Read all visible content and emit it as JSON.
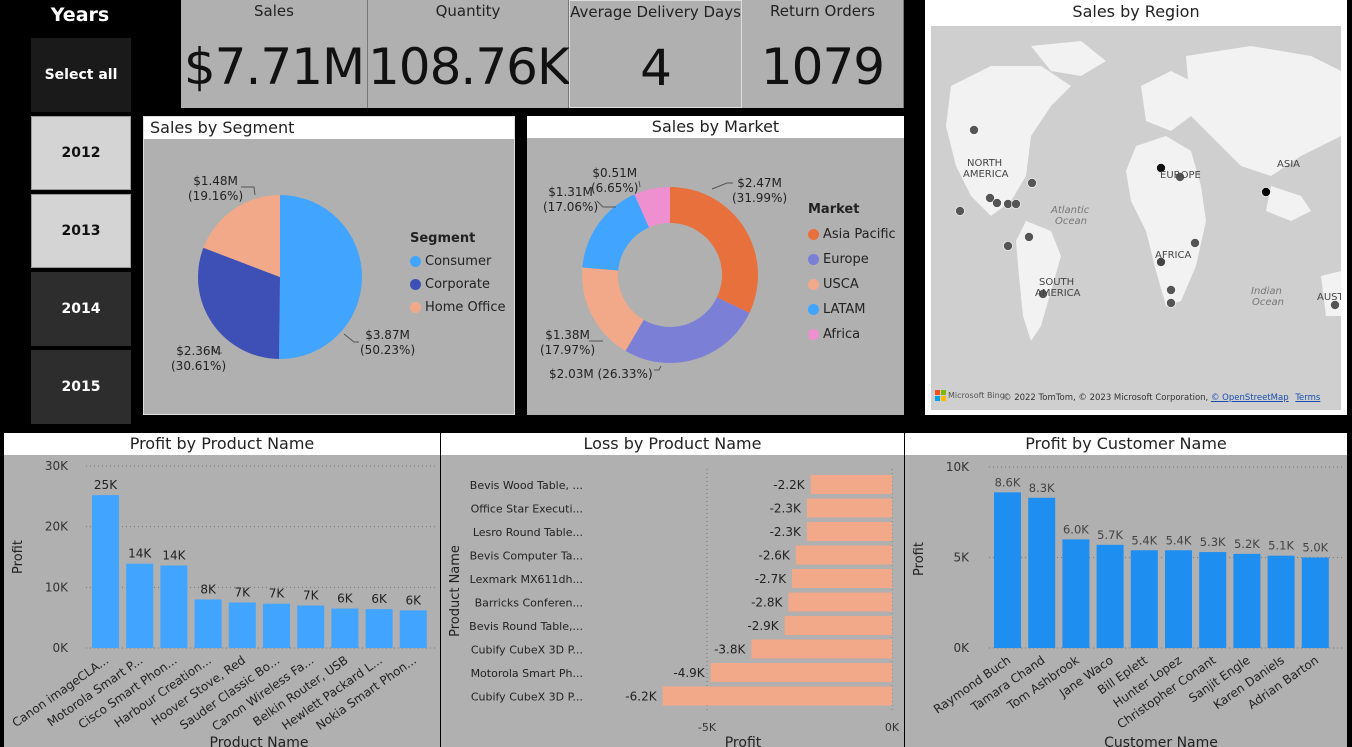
{
  "slicer": {
    "title": "Years",
    "items": [
      {
        "label": "Select all",
        "style": "sel"
      },
      {
        "label": "2012",
        "style": "light"
      },
      {
        "label": "2013",
        "style": "light"
      },
      {
        "label": "2014",
        "style": "dark"
      },
      {
        "label": "2015",
        "style": "dark"
      }
    ]
  },
  "kpis": [
    {
      "label": "Sales",
      "value": "$7.71M"
    },
    {
      "label": "Quantity",
      "value": "108.76K"
    },
    {
      "label": "Average Delivery Days",
      "value": "4"
    },
    {
      "label": "Return Orders",
      "value": "1079"
    }
  ],
  "map": {
    "title": "Sales by Region",
    "labels": [
      "NORTH\nAMERICA",
      "EUROPE",
      "ASIA",
      "AFRICA",
      "SOUTH\nAMERICA",
      "Atlantic\nOcean",
      "Indian\nOcean",
      "AUST"
    ],
    "bing_logo": "Microsoft Bing",
    "copyright": "© 2022 TomTom, © 2023 Microsoft Corporation,",
    "osm_link": "© OpenStreetMap",
    "terms_link": "Terms"
  },
  "segment": {
    "title": "Sales by Segment",
    "legend_title": "Segment",
    "labels": [
      {
        "value": "$3.87M",
        "pct": "(50.23%)"
      },
      {
        "value": "$2.36M",
        "pct": "(30.61%)"
      },
      {
        "value": "$1.48M",
        "pct": "(19.16%)"
      }
    ]
  },
  "market": {
    "title": "Sales by Market",
    "legend_title": "Market",
    "labels": [
      {
        "value": "$2.47M",
        "pct": "(31.99%)"
      },
      {
        "value": "$2.03M (26.33%)",
        "pct": ""
      },
      {
        "value": "$1.38M",
        "pct": "(17.97%)"
      },
      {
        "value": "$1.31M",
        "pct": "(17.06%)"
      },
      {
        "value": "$0.51M",
        "pct": "(6.65%)"
      }
    ]
  },
  "profit_product": {
    "title": "Profit by Product Name",
    "ylabel": "Profit",
    "xlabel": "Product Name",
    "yticks": [
      "30K",
      "20K",
      "10K",
      "0K"
    ]
  },
  "loss_product": {
    "title": "Loss by Product Name",
    "ylabel": "Product Name",
    "xlabel": "Profit",
    "xticks": [
      "-5K",
      "0K"
    ]
  },
  "profit_customer": {
    "title": "Profit by Customer Name",
    "ylabel": "Profit",
    "xlabel": "Customer Name",
    "yticks": [
      "10K",
      "5K",
      "0K"
    ]
  },
  "colors": {
    "consumer": "#41A4FF",
    "corporate": "#3E4FB5",
    "home_office": "#F2A98A",
    "asia_pacific": "#E8703C",
    "europe": "#7B7FD6",
    "usca": "#F2A98A",
    "latam": "#41A4FF",
    "africa": "#EE8FD0",
    "bar_blue": "#41A4FF",
    "bar_blue2": "#1E8EF0",
    "bar_salmon": "#F2A98A"
  },
  "chart_data": [
    {
      "type": "pie",
      "title": "Sales by Segment",
      "categories": [
        "Consumer",
        "Corporate",
        "Home Office"
      ],
      "values": [
        3.87,
        2.36,
        1.48
      ],
      "percents": [
        50.23,
        30.61,
        19.16
      ],
      "unit": "$M"
    },
    {
      "type": "pie",
      "subtype": "donut",
      "title": "Sales by Market",
      "categories": [
        "Asia Pacific",
        "Europe",
        "USCA",
        "LATAM",
        "Africa"
      ],
      "values": [
        2.47,
        2.03,
        1.38,
        1.31,
        0.51
      ],
      "percents": [
        31.99,
        26.33,
        17.97,
        17.06,
        6.65
      ],
      "unit": "$M"
    },
    {
      "type": "bar",
      "title": "Profit by Product Name",
      "xlabel": "Product Name",
      "ylabel": "Profit",
      "categories": [
        "Canon imageCLA...",
        "Motorola Smart P...",
        "Cisco Smart Phon...",
        "Harbour Creation...",
        "Hoover Stove, Red",
        "Sauder Classic Bo...",
        "Canon Wireless Fa...",
        "Belkin Router, USB",
        "Hewlett Packard L...",
        "Nokia Smart Phon..."
      ],
      "values": [
        25000,
        14000,
        14000,
        8000,
        7000,
        7000,
        7000,
        6000,
        6000,
        6000
      ],
      "data_labels": [
        "25K",
        "14K",
        "14K",
        "8K",
        "7K",
        "7K",
        "7K",
        "6K",
        "6K",
        "6K"
      ],
      "heights": [
        25.2,
        13.9,
        13.6,
        8.0,
        7.5,
        7.3,
        7.0,
        6.5,
        6.4,
        6.2
      ],
      "ylim": [
        0,
        30000
      ]
    },
    {
      "type": "bar",
      "orientation": "horizontal",
      "title": "Loss by Product Name",
      "xlabel": "Profit",
      "ylabel": "Product Name",
      "categories": [
        "Bevis Wood Table, ...",
        "Office Star Executi...",
        "Lesro Round Table...",
        "Bevis Computer Ta...",
        "Lexmark MX611dh...",
        "Barricks Conferen...",
        "Bevis Round Table,...",
        "Cubify CubeX 3D P...",
        "Motorola Smart Ph...",
        "Cubify CubeX 3D P..."
      ],
      "values": [
        -2200,
        -2300,
        -2300,
        -2600,
        -2700,
        -2800,
        -2900,
        -3800,
        -4900,
        -6200
      ],
      "data_labels": [
        "-2.2K",
        "-2.3K",
        "-2.3K",
        "-2.6K",
        "-2.7K",
        "-2.8K",
        "-2.9K",
        "-3.8K",
        "-4.9K",
        "-6.2K"
      ],
      "xlim": [
        -6500,
        0
      ]
    },
    {
      "type": "bar",
      "title": "Profit by Customer Name",
      "xlabel": "Customer Name",
      "ylabel": "Profit",
      "categories": [
        "Raymond Buch",
        "Tamara Chand",
        "Tom Ashbrook",
        "Jane Waco",
        "Bill Eplett",
        "Hunter Lopez",
        "Christopher Conant",
        "Sanjit Engle",
        "Karen Daniels",
        "Adrian Barton"
      ],
      "values": [
        8600,
        8300,
        6000,
        5700,
        5400,
        5400,
        5300,
        5200,
        5100,
        5000
      ],
      "data_labels": [
        "8.6K",
        "8.3K",
        "6.0K",
        "5.7K",
        "5.4K",
        "5.4K",
        "5.3K",
        "5.2K",
        "5.1K",
        "5.0K"
      ],
      "ylim": [
        0,
        10000
      ]
    }
  ]
}
